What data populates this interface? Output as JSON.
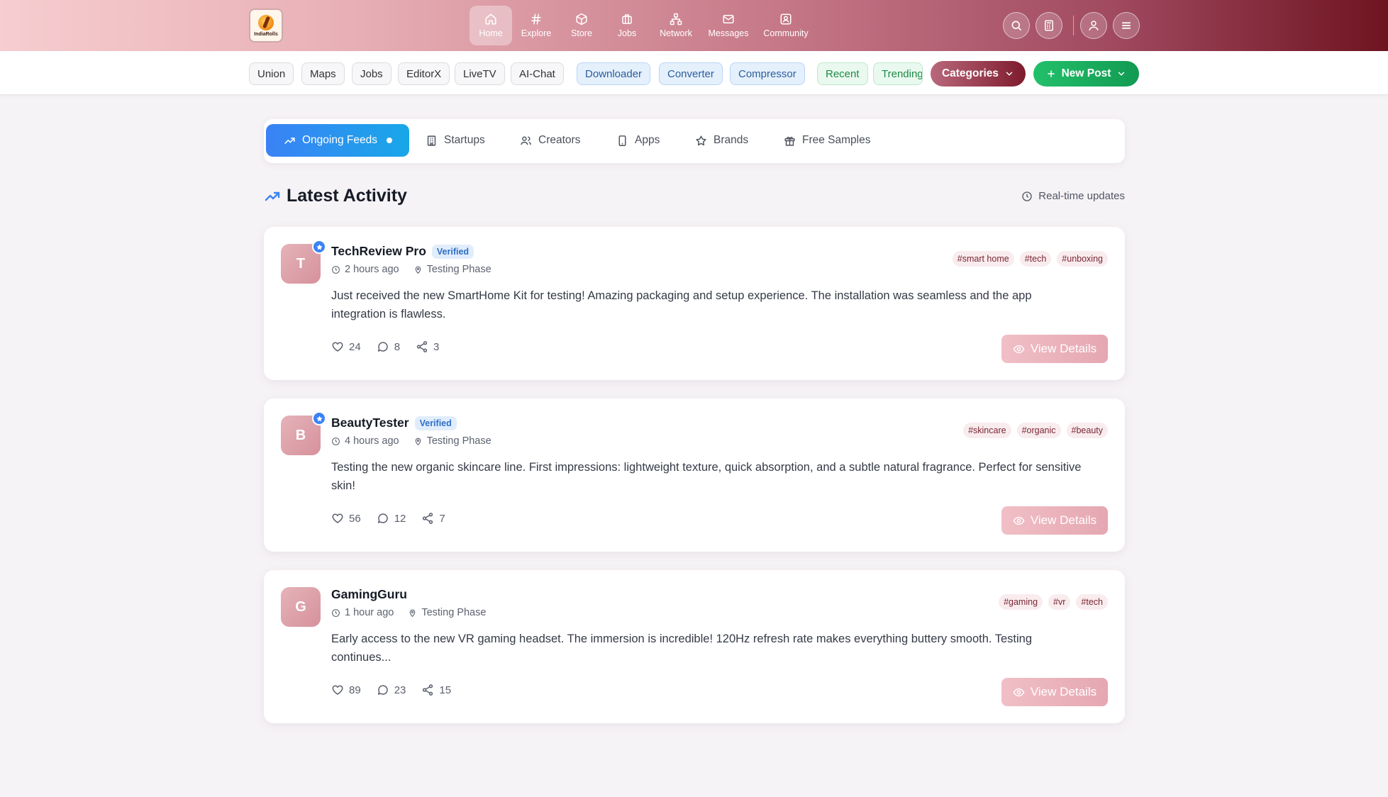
{
  "header": {
    "logo_text": "IndiaRolls",
    "nav": [
      {
        "label": "Home",
        "icon": "home-icon",
        "active": true
      },
      {
        "label": "Explore",
        "icon": "hash-icon"
      },
      {
        "label": "Store",
        "icon": "box-icon"
      },
      {
        "label": "Jobs",
        "icon": "briefcase-icon"
      },
      {
        "label": "Network",
        "icon": "network-icon"
      },
      {
        "label": "Messages",
        "icon": "mail-icon"
      },
      {
        "label": "Community",
        "icon": "community-icon"
      }
    ],
    "actions": [
      "search-icon",
      "calculator-icon",
      "user-icon",
      "menu-icon"
    ]
  },
  "quickbar": {
    "chips": [
      "Union",
      "Maps",
      "Jobs",
      "EditorX",
      "LiveTV",
      "AI-Chat"
    ],
    "tool_chips": [
      "Downloader",
      "Converter",
      "Compressor"
    ],
    "feed_chips": [
      "Recent",
      "Trending"
    ],
    "categories_label": "Categories",
    "new_post_label": "New Post"
  },
  "tabs": [
    {
      "label": "Ongoing Feeds",
      "icon": "trending-icon",
      "active": true
    },
    {
      "label": "Startups",
      "icon": "building-icon"
    },
    {
      "label": "Creators",
      "icon": "users-icon"
    },
    {
      "label": "Apps",
      "icon": "phone-icon"
    },
    {
      "label": "Brands",
      "icon": "star-icon"
    },
    {
      "label": "Free Samples",
      "icon": "gift-icon"
    }
  ],
  "section": {
    "title": "Latest Activity",
    "realtime_label": "Real-time updates"
  },
  "posts": [
    {
      "initial": "T",
      "author": "TechReview Pro",
      "verified": "Verified",
      "time": "2 hours ago",
      "phase": "Testing Phase",
      "tags": [
        "#smart home",
        "#tech",
        "#unboxing"
      ],
      "text": "Just received the new SmartHome Kit for testing! Amazing packaging and setup experience. The installation was seamless and the app integration is flawless.",
      "likes": "24",
      "comments": "8",
      "shares": "3",
      "cta": "View Details"
    },
    {
      "initial": "B",
      "author": "BeautyTester",
      "verified": "Verified",
      "time": "4 hours ago",
      "phase": "Testing Phase",
      "tags": [
        "#skincare",
        "#organic",
        "#beauty"
      ],
      "text": "Testing the new organic skincare line. First impressions: lightweight texture, quick absorption, and a subtle natural fragrance. Perfect for sensitive skin!",
      "likes": "56",
      "comments": "12",
      "shares": "7",
      "cta": "View Details"
    },
    {
      "initial": "G",
      "author": "GamingGuru",
      "time": "1 hour ago",
      "phase": "Testing Phase",
      "tags": [
        "#gaming",
        "#vr",
        "#tech"
      ],
      "text": "Early access to the new VR gaming headset. The immersion is incredible! 120Hz refresh rate makes everything buttery smooth. Testing continues...",
      "likes": "89",
      "comments": "23",
      "shares": "15",
      "cta": "View Details"
    }
  ]
}
